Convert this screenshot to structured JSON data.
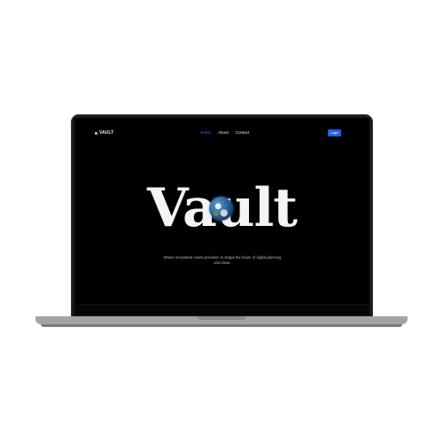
{
  "nav": {
    "logo_text": "VAULT",
    "links": [
      "Home",
      "About",
      "Contact"
    ],
    "active_index": 0
  },
  "login_label": "Login",
  "hero": {
    "title": "Vault",
    "subtitle": "Where innovation meets precision to shape the future of digital planning and ideas."
  },
  "colors": {
    "accent": "#1f5fe0",
    "active_link": "#2f7bff",
    "screen_bg": "#000000"
  },
  "icons": {
    "logo": "vault-logo-icon",
    "globe": "earth-globe-icon"
  }
}
